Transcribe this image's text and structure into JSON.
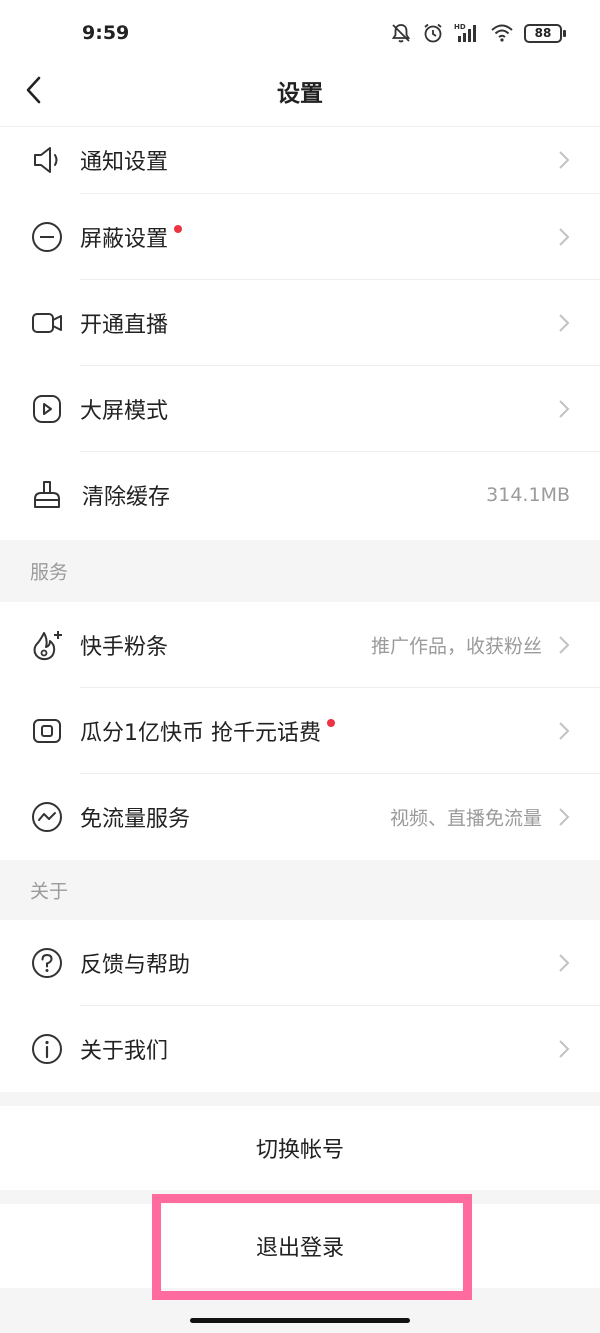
{
  "status_bar": {
    "time": "9:59",
    "battery": "88",
    "icons": [
      "mute-bell-icon",
      "alarm-icon",
      "hd-signal-icon",
      "wifi-icon",
      "battery-icon"
    ]
  },
  "header": {
    "title": "设置",
    "back_icon": "back-chevron-icon"
  },
  "settings": {
    "items": [
      {
        "label": "通知设置",
        "icon": "speaker-icon",
        "dot": false
      },
      {
        "label": "屏蔽设置",
        "icon": "minus-circle-icon",
        "dot": true
      },
      {
        "label": "开通直播",
        "icon": "camera-icon",
        "dot": false
      },
      {
        "label": "大屏模式",
        "icon": "play-square-icon",
        "dot": false
      },
      {
        "label": "清除缓存",
        "icon": "brush-icon",
        "value": "314.1MB"
      }
    ]
  },
  "services": {
    "header": "服务",
    "items": [
      {
        "label": "快手粉条",
        "icon": "flame-plus-icon",
        "value": "推广作品，收获粉丝"
      },
      {
        "label": "瓜分1亿快币 抢千元话费",
        "icon": "coin-card-icon",
        "dot": true
      },
      {
        "label": "免流量服务",
        "icon": "trend-circle-icon",
        "value": "视频、直播免流量"
      }
    ]
  },
  "about": {
    "header": "关于",
    "items": [
      {
        "label": "反馈与帮助",
        "icon": "question-circle-icon"
      },
      {
        "label": "关于我们",
        "icon": "info-circle-icon"
      }
    ]
  },
  "actions": {
    "switch_account": "切换帐号",
    "logout": "退出登录"
  },
  "colors": {
    "accent_dot": "#ee3344",
    "highlight": "#ff6b9e",
    "gap_bg": "#f5f5f5"
  }
}
